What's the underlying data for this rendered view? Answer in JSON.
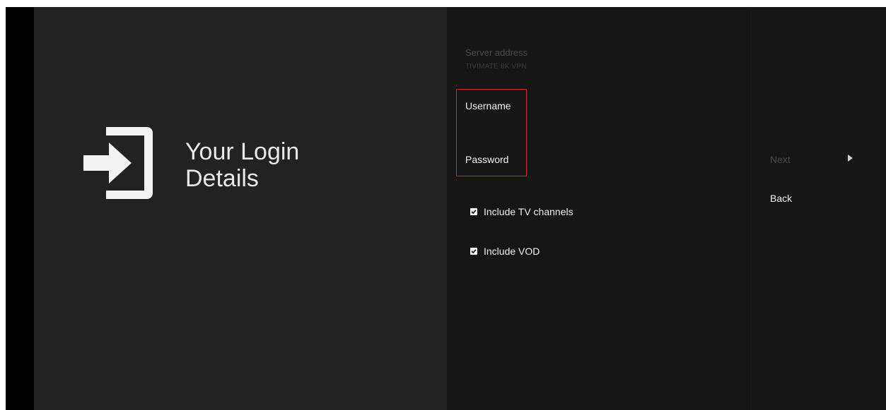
{
  "left": {
    "title_line1": "Your Login",
    "title_line2": "Details",
    "icon": "login-icon"
  },
  "form": {
    "server_label": "Server address",
    "server_value": "TIVIMATE 8K VPN",
    "username_label": "Username",
    "password_label": "Password",
    "include_tv_label": "Include TV channels",
    "include_tv_checked": true,
    "include_vod_label": "Include VOD",
    "include_vod_checked": true
  },
  "actions": {
    "next_label": "Next",
    "next_icon": "chevron-right-icon",
    "back_label": "Back"
  },
  "colors": {
    "focus_border": "#d9252b",
    "left_panel_bg": "#222222",
    "form_panel_bg": "#161616"
  }
}
